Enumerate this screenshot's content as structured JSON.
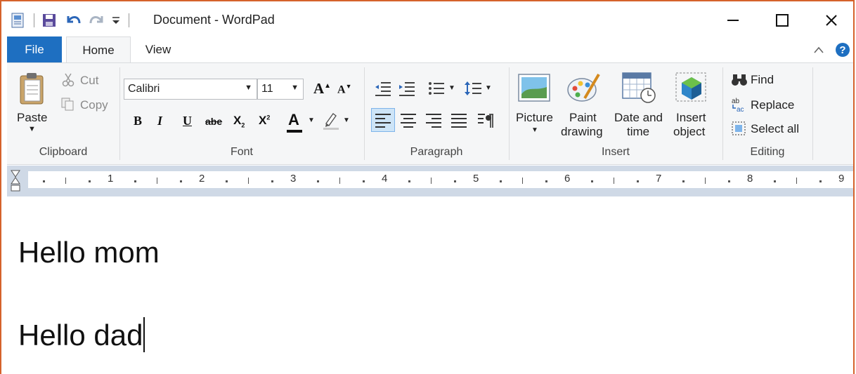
{
  "window": {
    "title": "Document - WordPad",
    "minimize_icon": "minimize-icon",
    "maximize_icon": "maximize-icon",
    "close_icon": "close-icon"
  },
  "quick_access": {
    "icons": [
      "wordpad-app-icon",
      "save-icon",
      "undo-icon",
      "redo-icon",
      "customize-dropdown-icon"
    ]
  },
  "tabs": {
    "file": "File",
    "home": "Home",
    "view": "View"
  },
  "ribbon": {
    "clipboard": {
      "paste": "Paste",
      "cut": "Cut",
      "copy": "Copy",
      "label": "Clipboard"
    },
    "font": {
      "family": "Calibri",
      "size": "11",
      "label": "Font",
      "bold": "B",
      "italic": "I",
      "underline": "U",
      "strikethrough": "abe",
      "subscript": "X",
      "superscript": "X",
      "grow": "A",
      "shrink": "A",
      "color": "A"
    },
    "paragraph": {
      "label": "Paragraph"
    },
    "insert": {
      "picture": "Picture",
      "paint_line1": "Paint",
      "paint_line2": "drawing",
      "datetime_line1": "Date and",
      "datetime_line2": "time",
      "object_line1": "Insert",
      "object_line2": "object",
      "label": "Insert"
    },
    "editing": {
      "find": "Find",
      "replace": "Replace",
      "select_all": "Select all",
      "label": "Editing"
    }
  },
  "ruler": {
    "numbers": [
      "1",
      "2",
      "3",
      "4",
      "5",
      "6",
      "7",
      "8",
      "9"
    ]
  },
  "document": {
    "lines": [
      "Hello mom",
      "Hello dad"
    ]
  },
  "colors": {
    "file_tab": "#1e6fc1",
    "window_border": "#d5622b",
    "ribbon_bg": "#f5f6f7",
    "ruler_bg": "#cfd9e6"
  }
}
